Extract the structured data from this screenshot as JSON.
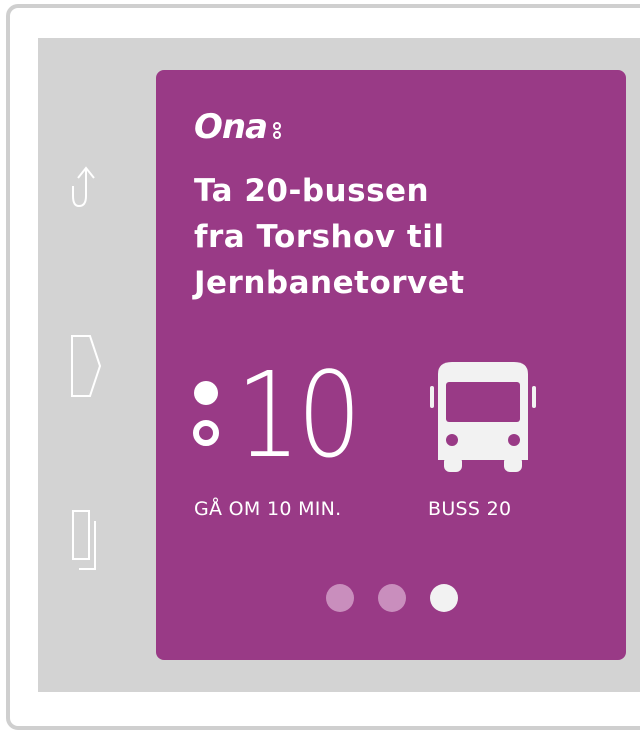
{
  "card": {
    "brand": "Ona",
    "headline": [
      "Ta 20-bussen",
      "fra Torshov til",
      "Jernbanetorvet"
    ],
    "time_value": "10",
    "walk_label": "GÅ OM 10 MIN.",
    "bus_label": "BUSS 20"
  },
  "side_buttons": [
    {
      "icon": "up-arrow-icon"
    },
    {
      "icon": "next-chevron-icon"
    },
    {
      "icon": "copy-pages-icon"
    }
  ],
  "pager": {
    "pages": 3,
    "active_index": 2
  },
  "colors": {
    "card_background": "#993a86",
    "screen_background": "#d3d3d3",
    "frame": "#cfcfcf",
    "icon": "#ffffff",
    "inactive_dot": "#c98ebd",
    "active_dot": "#f2f2f2"
  }
}
